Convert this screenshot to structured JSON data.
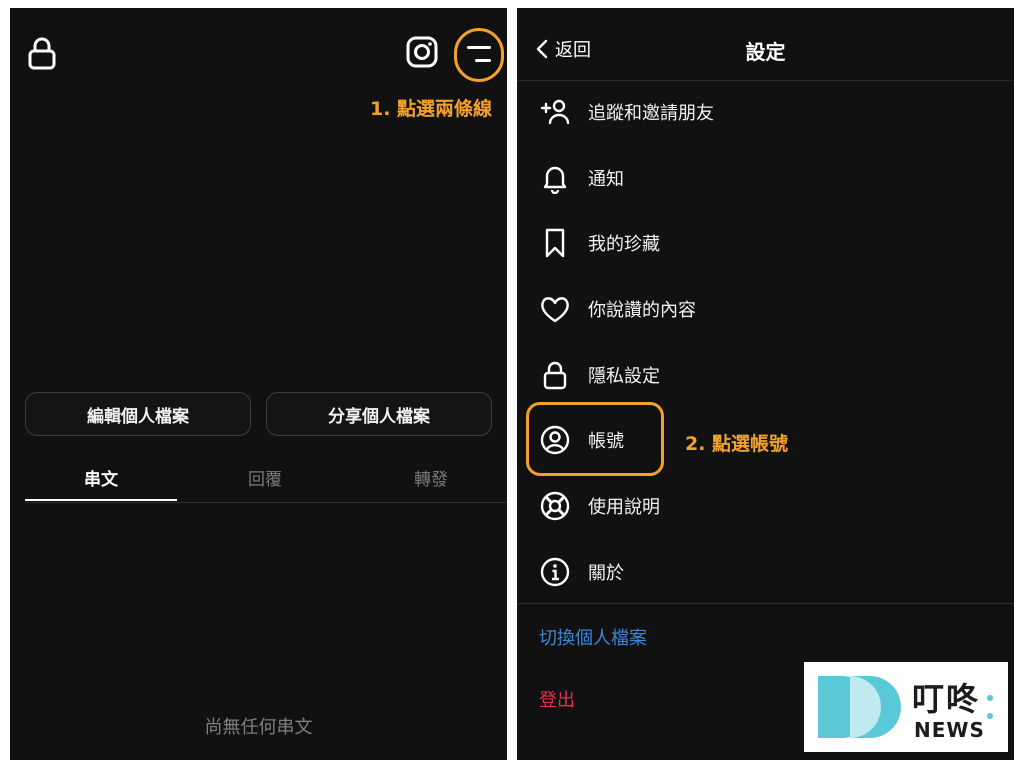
{
  "left_screen": {
    "annotation": "1. 點選兩條線",
    "buttons": {
      "edit_profile": "編輯個人檔案",
      "share_profile": "分享個人檔案"
    },
    "tabs": [
      {
        "label": "串文",
        "active": true
      },
      {
        "label": "回覆",
        "active": false
      },
      {
        "label": "轉發",
        "active": false
      }
    ],
    "empty_state": "尚無任何串文",
    "icons": {
      "top_left": "lock-icon",
      "top_right": [
        "instagram-icon",
        "menu-two-lines-icon"
      ]
    }
  },
  "right_screen": {
    "header": {
      "back_label": "返回",
      "title": "設定"
    },
    "menu": [
      {
        "label": "追蹤和邀請朋友",
        "icon": "add-person-icon"
      },
      {
        "label": "通知",
        "icon": "bell-icon"
      },
      {
        "label": "我的珍藏",
        "icon": "bookmark-icon"
      },
      {
        "label": "你說讚的內容",
        "icon": "heart-icon"
      },
      {
        "label": "隱私設定",
        "icon": "lock-icon"
      },
      {
        "label": "帳號",
        "icon": "account-circle-icon"
      },
      {
        "label": "使用說明",
        "icon": "lifebuoy-icon"
      },
      {
        "label": "關於",
        "icon": "info-icon"
      }
    ],
    "annotation": "2. 點選帳號",
    "switch_profile": "切換個人檔案",
    "logout": "登出"
  },
  "logo": {
    "cn": "叮咚",
    "en": "NEWS"
  },
  "colors": {
    "background": "#111111",
    "highlight": "#f2a12c",
    "link_blue": "#3f86d8",
    "logout_red": "#e0304f",
    "logo_cyan": "#5bc8d8"
  }
}
